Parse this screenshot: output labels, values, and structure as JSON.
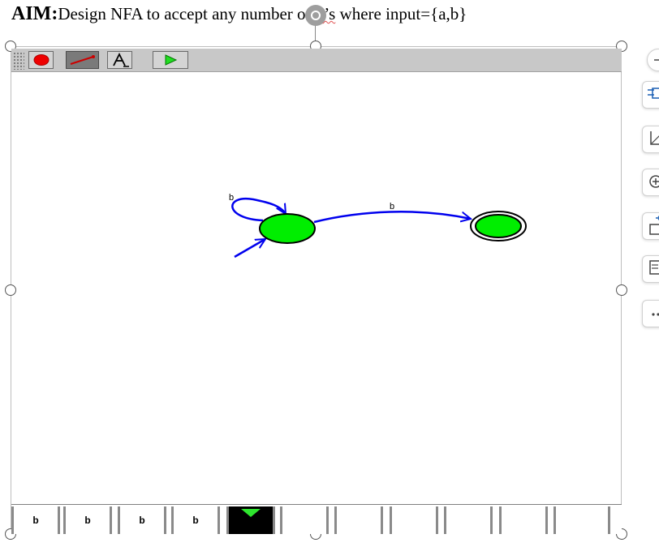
{
  "document": {
    "aim_label": "AIM:",
    "aim_text_before": "Design NFA to accept any number of ",
    "aim_text_word": "b’s",
    "aim_text_after": " where input={a,b}"
  },
  "toolbar": {
    "tools": [
      {
        "name": "state-tool",
        "icon": "red-circle-icon",
        "active": false
      },
      {
        "name": "transition-tool",
        "icon": "arrow-line-icon",
        "active": true
      },
      {
        "name": "label-tool",
        "icon": "text-A-icon",
        "active": false
      },
      {
        "name": "run-tool",
        "icon": "play-icon",
        "active": false
      }
    ]
  },
  "automaton": {
    "state_color": "#00ee00",
    "edge_color": "#0000ee",
    "self_loop_label": "b",
    "transition_label": "b"
  },
  "tape": {
    "cells": [
      "b",
      "b",
      "b",
      "b",
      "",
      "",
      "",
      "",
      "",
      "",
      ""
    ],
    "head_index": 4,
    "head_color": "#2ee62e"
  },
  "side_panel": {
    "buttons": [
      "collapse-icon",
      "layout-icon",
      "crop-icon",
      "zoom-in-icon",
      "alt-text-icon",
      "wrap-text-icon",
      "more-icon"
    ]
  }
}
